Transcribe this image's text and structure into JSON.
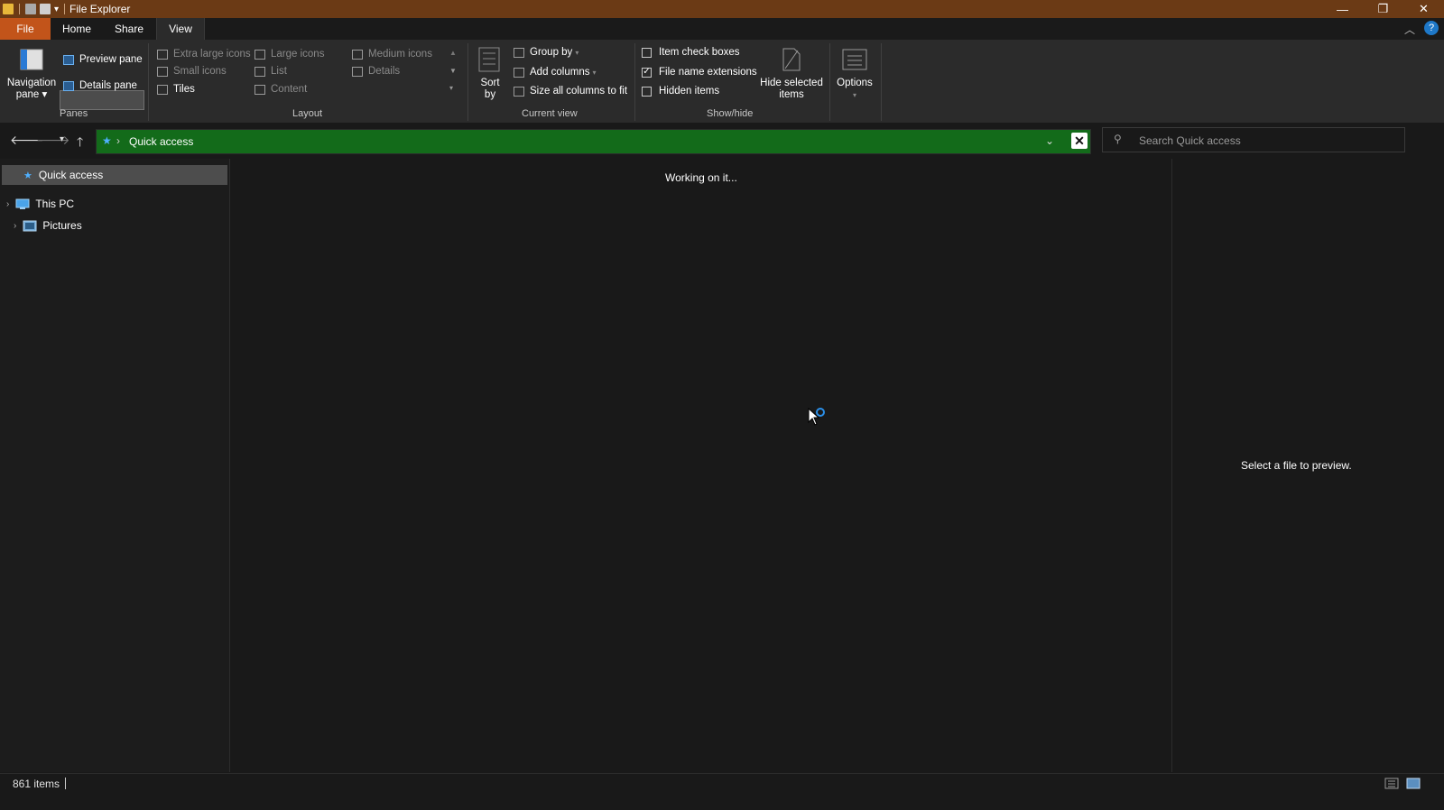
{
  "window": {
    "title": "File Explorer",
    "minimize": "—",
    "maximize": "❐",
    "close": "✕"
  },
  "tabs": {
    "file": "File",
    "home": "Home",
    "share": "Share",
    "view": "View"
  },
  "ribbon": {
    "panes": {
      "group_label": "Panes",
      "navigation_pane": "Navigation pane",
      "preview_pane": "Preview pane",
      "details_pane": "Details pane"
    },
    "layout": {
      "group_label": "Layout",
      "extra_large_icons": "Extra large icons",
      "large_icons": "Large icons",
      "medium_icons": "Medium icons",
      "small_icons": "Small icons",
      "list": "List",
      "details": "Details",
      "tiles": "Tiles",
      "content": "Content"
    },
    "current_view": {
      "group_label": "Current view",
      "sort_by": "Sort by",
      "group_by": "Group by",
      "add_columns": "Add columns",
      "size_all_columns": "Size all columns to fit"
    },
    "show_hide": {
      "group_label": "Show/hide",
      "item_check_boxes": "Item check boxes",
      "item_check_boxes_checked": false,
      "file_name_extensions": "File name extensions",
      "file_name_extensions_checked": true,
      "hidden_items": "Hidden items",
      "hidden_items_checked": false,
      "hide_selected_items": "Hide selected items"
    },
    "options": "Options"
  },
  "address": {
    "location": "Quick access",
    "search_placeholder": "Search Quick access"
  },
  "nav_pane": {
    "items": [
      {
        "label": "Quick access",
        "selected": true
      },
      {
        "label": "This PC"
      },
      {
        "label": "Pictures"
      }
    ]
  },
  "content": {
    "status_message": "Working on it..."
  },
  "preview": {
    "message": "Select a file to preview."
  },
  "status_bar": {
    "item_count": "861 items"
  },
  "colors": {
    "title_bar": "#6b3a15",
    "file_tab": "#c2541a",
    "address_bar": "#136b1a",
    "accent": "#1e78c8"
  }
}
